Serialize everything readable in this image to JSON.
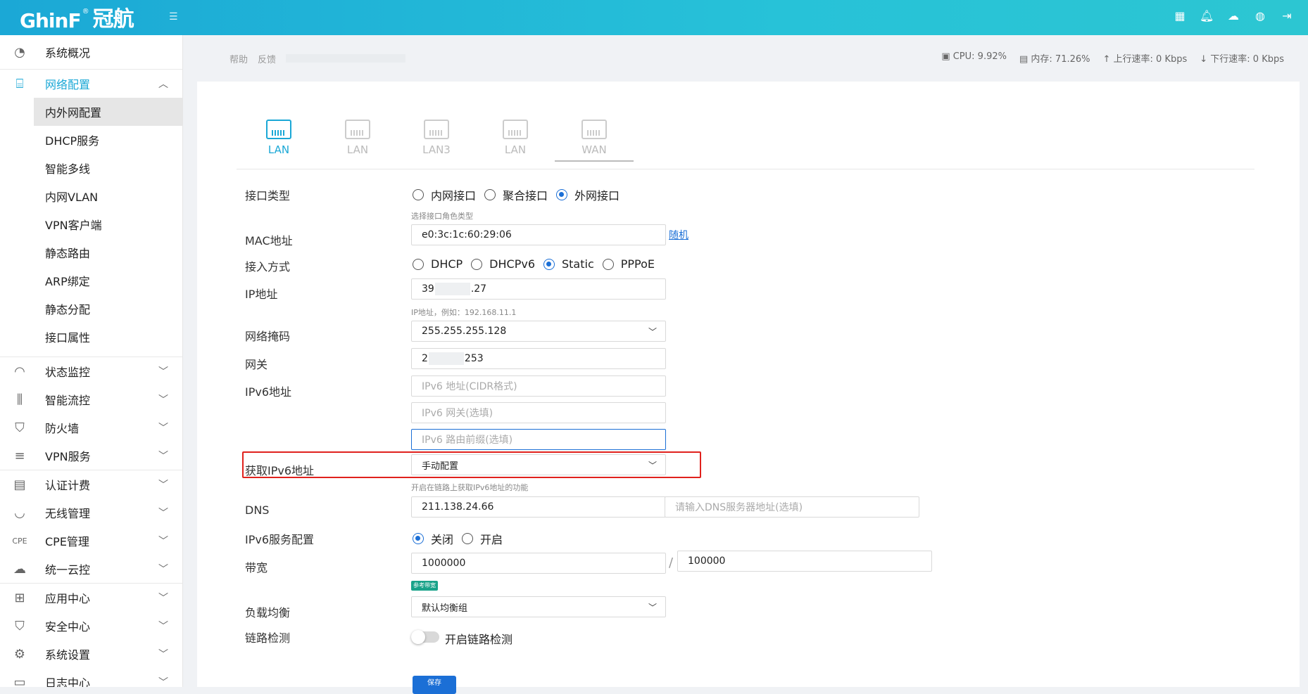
{
  "brand": {
    "logo_text": "GhinF",
    "logo_cn": "冠航",
    "reg": "®"
  },
  "topbar": {
    "icons": [
      "qrcode-icon",
      "bell-icon",
      "cloud-icon",
      "globe-icon",
      "logout-icon"
    ]
  },
  "sidebar": {
    "items": [
      {
        "label": "系统概况",
        "icon": "dashboard-icon"
      },
      {
        "label": "网络配置",
        "icon": "router-icon",
        "expanded": true
      },
      {
        "label": "状态监控",
        "icon": "gauge-icon"
      },
      {
        "label": "智能流控",
        "icon": "sliders-icon"
      },
      {
        "label": "防火墙",
        "icon": "shield-icon"
      },
      {
        "label": "VPN服务",
        "icon": "vpn-icon"
      },
      {
        "label": "认证计费",
        "icon": "auth-icon"
      },
      {
        "label": "无线管理",
        "icon": "wifi-icon"
      },
      {
        "label": "CPE管理",
        "icon": "cpe-icon"
      },
      {
        "label": "统一云控",
        "icon": "cloud-icon"
      },
      {
        "label": "应用中心",
        "icon": "apps-icon"
      },
      {
        "label": "安全中心",
        "icon": "security-icon"
      },
      {
        "label": "系统设置",
        "icon": "settings-icon"
      },
      {
        "label": "日志中心",
        "icon": "log-icon"
      }
    ],
    "sub_items": [
      "内外网配置",
      "DHCP服务",
      "智能多线",
      "内网VLAN",
      "VPN客户端",
      "静态路由",
      "ARP绑定",
      "静态分配",
      "接口属性"
    ]
  },
  "breadcrumb": {
    "help": "帮助",
    "feedback": "反馈"
  },
  "stats": {
    "cpu": "CPU: 9.92%",
    "mem": "内存: 71.26%",
    "up": "上行速率: 0 Kbps",
    "down": "下行速率: 0 Kbps"
  },
  "tabs": [
    "LAN",
    "LAN",
    "LAN3",
    "LAN",
    "WAN"
  ],
  "form": {
    "iface_type_label": "接口类型",
    "iface_opts": [
      "内网接口",
      "聚合接口",
      "外网接口"
    ],
    "iface_hint": "选择接口角色类型",
    "mac_label": "MAC地址",
    "mac_value": "e0:3c:1c:60:29:06",
    "random_link": "随机",
    "access_label": "接入方式",
    "access_opts": [
      "DHCP",
      "DHCPv6",
      "Static",
      "PPPoE"
    ],
    "ip_label": "IP地址",
    "ip_prefix": "39",
    "ip_suffix": ".27",
    "ip_hint": "IP地址，例如：192.168.11.1",
    "mask_label": "网络掩码",
    "mask_value": "255.255.255.128",
    "gw_label": "网关",
    "gw_prefix": "2",
    "gw_suffix": "253",
    "ipv6_label": "IPv6地址",
    "ipv6_ph": "IPv6 地址(CIDR格式)",
    "ipv6_gw_ph": "IPv6 网关(选填)",
    "ipv6_prefix_ph": "IPv6 路由前缀(选填)",
    "get_ipv6_label": "获取IPv6地址",
    "get_ipv6_value": "手动配置",
    "get_ipv6_hint": "开启在链路上获取IPv6地址的功能",
    "dns_label": "DNS",
    "dns_value": "211.138.24.66",
    "dns2_ph": "请输入DNS服务器地址(选填)",
    "ipv6svc_label": "IPv6服务配置",
    "ipv6svc_opts": [
      "关闭",
      "开启"
    ],
    "bw_label": "带宽",
    "bw_up": "1000000",
    "bw_sep": "/",
    "bw_down": "100000",
    "bw_badge": "参考带宽",
    "lb_label": "负载均衡",
    "lb_value": "默认均衡组",
    "link_label": "链路检测",
    "link_toggle": "开启链路检测",
    "save": "保存"
  }
}
